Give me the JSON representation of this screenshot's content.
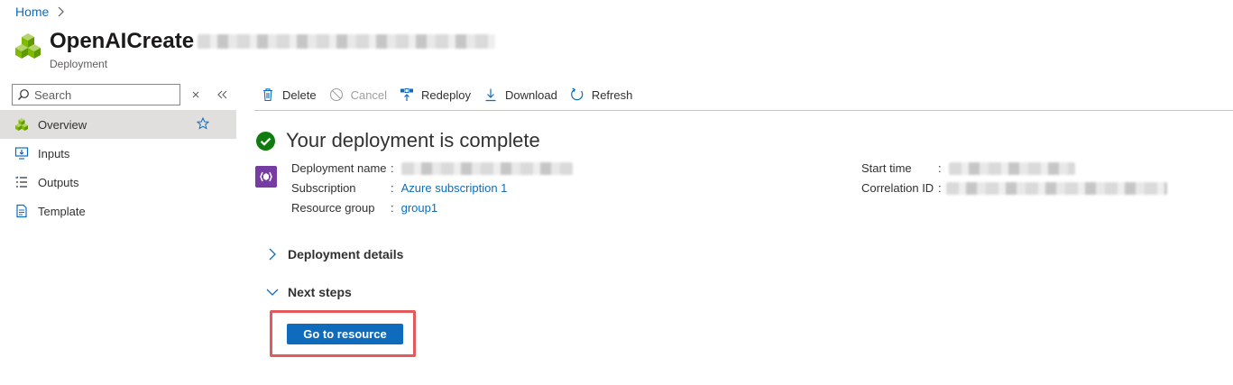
{
  "breadcrumb": {
    "home": "Home"
  },
  "header": {
    "title": "OpenAICreate",
    "subtitle": "Deployment"
  },
  "sidebar": {
    "search_placeholder": "Search",
    "items": [
      {
        "label": "Overview",
        "icon": "cubes-icon",
        "active": true
      },
      {
        "label": "Inputs",
        "icon": "inputs-icon"
      },
      {
        "label": "Outputs",
        "icon": "outputs-icon"
      },
      {
        "label": "Template",
        "icon": "template-icon"
      }
    ]
  },
  "toolbar": {
    "delete": "Delete",
    "cancel": "Cancel",
    "redeploy": "Redeploy",
    "download": "Download",
    "refresh": "Refresh"
  },
  "status": {
    "title": "Your deployment is complete"
  },
  "details": {
    "deployment_name_label": "Deployment name",
    "subscription_label": "Subscription",
    "subscription_value": "Azure subscription 1",
    "resource_group_label": "Resource group",
    "resource_group_value": "group1",
    "start_time_label": "Start time",
    "correlation_id_label": "Correlation ID",
    "separator": ":"
  },
  "sections": {
    "deployment_details": "Deployment details",
    "next_steps": "Next steps"
  },
  "actions": {
    "go_to_resource": "Go to resource"
  },
  "colors": {
    "accent": "#0f6cbd",
    "success": "#107c10",
    "highlight_border": "#e35a5c",
    "active_nav": "#e1dfdd"
  }
}
